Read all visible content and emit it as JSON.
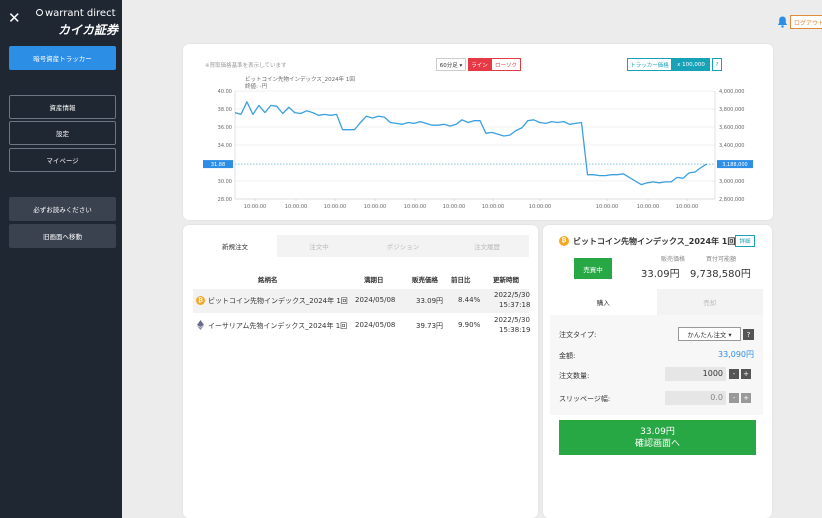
{
  "sidebar": {
    "brand_top": "warrant direct",
    "brand_bottom": "カイカ証券",
    "items": [
      {
        "label": "暗号資産トラッカー"
      },
      {
        "label": "資産情報"
      },
      {
        "label": "設定"
      },
      {
        "label": "マイページ"
      },
      {
        "label": "必ずお読みください"
      },
      {
        "label": "旧画面へ移動"
      }
    ]
  },
  "header": {
    "logout_label": "ログアウト"
  },
  "chart": {
    "note": "※買取価格基準を表示しています",
    "period_label": "60分足 ▾",
    "line_label": "ライン",
    "candle_label": "ローソク",
    "tracker_label": "トラッカー価格",
    "multiplier_label": "x 100,000",
    "help_label": "?",
    "current_left": "31.88",
    "current_right": "3,188,000"
  },
  "chart_data": {
    "type": "line",
    "title": "ビットコイン先物インデックス_2024年 1回",
    "subtitle": "終値: -円",
    "xlabel": "",
    "ylabel": "",
    "x_ticks": [
      "10:00:00",
      "10:00:00",
      "10:00:00",
      "10:00:00",
      "10:00:00",
      "10:00:00",
      "10:00:00",
      "10:00:00",
      "10:00:00",
      "10:00:00",
      "10:00:00"
    ],
    "y_left_ticks": [
      "40.00",
      "38.00",
      "36.00",
      "34.00",
      "31.88",
      "30.00",
      "28.00"
    ],
    "y_right_ticks": [
      "4,000,000",
      "3,800,000",
      "3,600,000",
      "3,400,000",
      "3,188,000",
      "3,000,000",
      "2,800,000"
    ],
    "ylim": [
      28,
      40
    ],
    "grid": true,
    "series": [
      {
        "color": "#3aa0e0",
        "values": [
          37.6,
          37.4,
          38.8,
          37.4,
          38.4,
          37.6,
          38.4,
          38.3,
          37.5,
          38.2,
          37.6,
          37.5,
          37.8,
          37.6,
          37.3,
          37.4,
          37.3,
          37.4,
          35.7,
          35.7,
          35.7,
          36.5,
          37.2,
          37.0,
          37.2,
          37.1,
          36.5,
          36.4,
          36.3,
          36.5,
          36.4,
          36.6,
          36.4,
          36.2,
          36.2,
          36.3,
          36.1,
          36.3,
          36.8,
          36.5,
          36.7,
          36.7,
          35.3,
          35.4,
          35.2,
          35.0,
          35.1,
          35.6,
          35.9,
          36.7,
          36.8,
          36.5,
          36.4,
          36.6,
          36.5,
          36.6,
          36.3,
          36.4,
          36.5,
          30.7,
          30.7,
          30.6,
          30.6,
          30.7,
          30.7,
          30.8,
          30.4,
          30.0,
          29.6,
          29.8,
          29.9,
          29.8,
          29.9,
          29.9,
          30.4,
          30.3,
          30.9,
          31.0,
          31.5,
          31.9
        ]
      }
    ]
  },
  "order_tabs": [
    "新規注文",
    "注文中",
    "ポジション",
    "注文履歴"
  ],
  "table": {
    "headers": [
      "銘柄名",
      "満期日",
      "販売価格",
      "前日比",
      "更新時間"
    ],
    "rows": [
      {
        "name": "ビットコイン先物インデックス_2024年 1回",
        "date": "2024/05/08",
        "price": "33.09円",
        "change": "8.44%",
        "time1": "2022/5/30",
        "time2": "15:37:18"
      },
      {
        "name": "イーサリアム先物インデックス_2024年 1回",
        "date": "2024/05/08",
        "price": "39.73円",
        "change": "9.90%",
        "time1": "2022/5/30",
        "time2": "15:38:19"
      }
    ]
  },
  "panel": {
    "title": "ビットコイン先物インデックス_2024年 1回",
    "detail_label": "詳細",
    "status_label": "売買中",
    "sale_price_label": "販売価格",
    "sale_price": "33.09円",
    "buyable_label": "買付可能額",
    "buyable": "9,738,580円",
    "tab_buy": "購入",
    "tab_sell": "売却",
    "order_type_label": "注文タイプ:",
    "order_type_value": "かんたん注文 ▾",
    "help": "?",
    "amount_label": "金額:",
    "amount_value": "33,090円",
    "qty_label": "注文数量:",
    "qty_value": "1000",
    "slip_label": "スリッページ幅:",
    "slip_value": "0.0",
    "minus": "-",
    "plus": "+",
    "confirm_price": "33.09円",
    "confirm_label": "確認画面へ"
  }
}
